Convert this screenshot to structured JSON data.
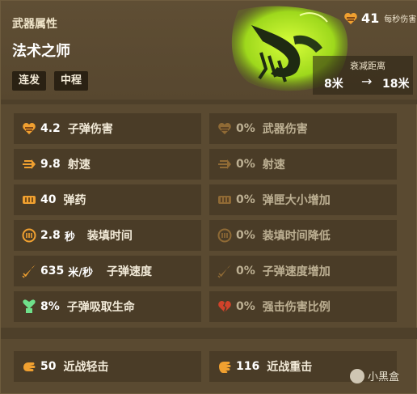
{
  "header": {
    "category": "武器属性",
    "weapon_name": "法术之师",
    "tags": [
      "连发",
      "中程"
    ],
    "dps": {
      "value": "41",
      "label": "每秒伤害"
    },
    "falloff": {
      "label": "衰减距离",
      "from": "8米",
      "to": "18米",
      "arrow": "→"
    }
  },
  "stats_left": [
    {
      "icon": "heart-bullet-icon",
      "value": "4.2",
      "unit": "",
      "label": "子弹伤害"
    },
    {
      "icon": "fire-rate-icon",
      "value": "9.8",
      "unit": "",
      "label": "射速"
    },
    {
      "icon": "ammo-icon",
      "value": "40",
      "unit": "",
      "label": "弹药"
    },
    {
      "icon": "reload-icon",
      "value": "2.8",
      "unit": "秒",
      "label": "装填时间"
    },
    {
      "icon": "bullet-velocity-icon",
      "value": "635",
      "unit": "米/秒",
      "label": "子弹速度"
    },
    {
      "icon": "lifesteal-icon",
      "value": "8%",
      "unit": "",
      "label": "子弹吸取生命"
    }
  ],
  "stats_right": [
    {
      "icon": "weapon-damage-icon",
      "value": "0%",
      "label": "武器伤害"
    },
    {
      "icon": "fire-rate-icon",
      "value": "0%",
      "label": "射速"
    },
    {
      "icon": "ammo-icon",
      "value": "0%",
      "label": "弹匣大小增加"
    },
    {
      "icon": "reload-icon",
      "value": "0%",
      "label": "装填时间降低"
    },
    {
      "icon": "bullet-velocity-icon",
      "value": "0%",
      "label": "子弹速度增加"
    },
    {
      "icon": "broken-heart-icon",
      "value": "0%",
      "label": "强击伤害比例"
    }
  ],
  "melee": [
    {
      "icon": "light-melee-icon",
      "value": "50",
      "label": "近战轻击"
    },
    {
      "icon": "heavy-melee-icon",
      "value": "116",
      "label": "近战重击"
    }
  ],
  "watermark": "小黑盒",
  "colors": {
    "accent_orange": "#f0a030",
    "dim_orange": "#8f6a35",
    "panel": "#5a4a31",
    "row": "#4a3c27",
    "lifesteal_green": "#6fe08a",
    "broken_heart_red": "#d0422a"
  }
}
